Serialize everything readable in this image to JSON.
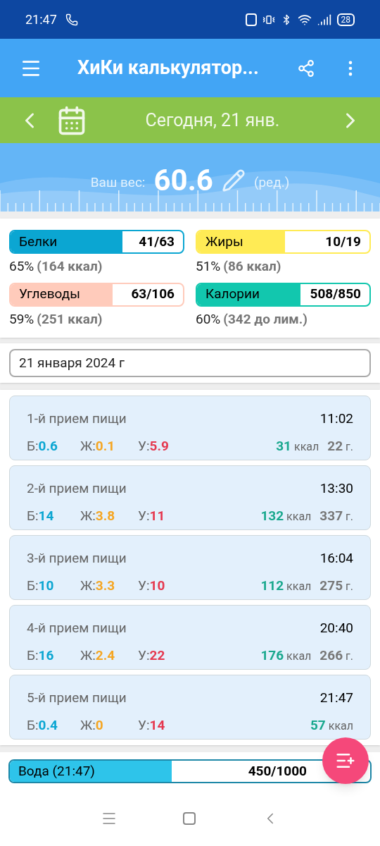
{
  "status_bar": {
    "time": "21:47",
    "battery": "28"
  },
  "app_bar": {
    "title": "ХиКи калькулятор..."
  },
  "date_bar": {
    "label": "Сегодня, 21 янв."
  },
  "weight": {
    "label": "Ваш вес:",
    "value": "60.6",
    "edit": "(ред.)"
  },
  "macros": [
    {
      "name": "Белки",
      "amount": "41/63",
      "level": 0.65,
      "color": "#0ba6d2",
      "percent": "65%",
      "detail": "(164 ккал)"
    },
    {
      "name": "Жиры",
      "amount": "10/19",
      "level": 0.51,
      "color": "#ffeb55",
      "percent": "51%",
      "detail": "(86 ккал)"
    },
    {
      "name": "Углеводы",
      "amount": "63/106",
      "level": 0.59,
      "color": "#ffcbbb",
      "percent": "59%",
      "detail": "(251 ккал)"
    },
    {
      "name": "Калории",
      "amount": "508/850",
      "level": 0.6,
      "color": "#12c7ae",
      "percent": "60%",
      "detail": "(342 до лим.)"
    }
  ],
  "date_field": {
    "value": "21 января 2024 г"
  },
  "meals": [
    {
      "name": "1-й прием пищи",
      "time": "11:02",
      "protein_label": "Б:",
      "protein": "0.6",
      "fat_label": "Ж:",
      "fat": "0.1",
      "carbs_label": "У:",
      "carbs": "5.9",
      "kcal": "31",
      "kcal_unit": "ккал",
      "grams": "22",
      "grams_unit": "г."
    },
    {
      "name": "2-й прием пищи",
      "time": "13:30",
      "protein_label": "Б:",
      "protein": "14",
      "fat_label": "Ж:",
      "fat": "3.8",
      "carbs_label": "У:",
      "carbs": "11",
      "kcal": "132",
      "kcal_unit": "ккал",
      "grams": "337",
      "grams_unit": "г."
    },
    {
      "name": "3-й прием пищи",
      "time": "16:04",
      "protein_label": "Б:",
      "protein": "10",
      "fat_label": "Ж:",
      "fat": "3.3",
      "carbs_label": "У:",
      "carbs": "10",
      "kcal": "112",
      "kcal_unit": "ккал",
      "grams": "275",
      "grams_unit": "г."
    },
    {
      "name": "4-й прием пищи",
      "time": "20:40",
      "protein_label": "Б:",
      "protein": "16",
      "fat_label": "Ж:",
      "fat": "2.4",
      "carbs_label": "У:",
      "carbs": "22",
      "kcal": "176",
      "kcal_unit": "ккал",
      "grams": "266",
      "grams_unit": "г."
    },
    {
      "name": "5-й прием пищи",
      "time": "21:47",
      "protein_label": "Б:",
      "protein": "0.4",
      "fat_label": "Ж:",
      "fat": "0",
      "carbs_label": "У:",
      "carbs": "14",
      "kcal": "57",
      "kcal_unit": "ккал"
    }
  ],
  "water": {
    "label": "Вода (21:47)",
    "amount": "450/1000",
    "level": 0.45
  }
}
